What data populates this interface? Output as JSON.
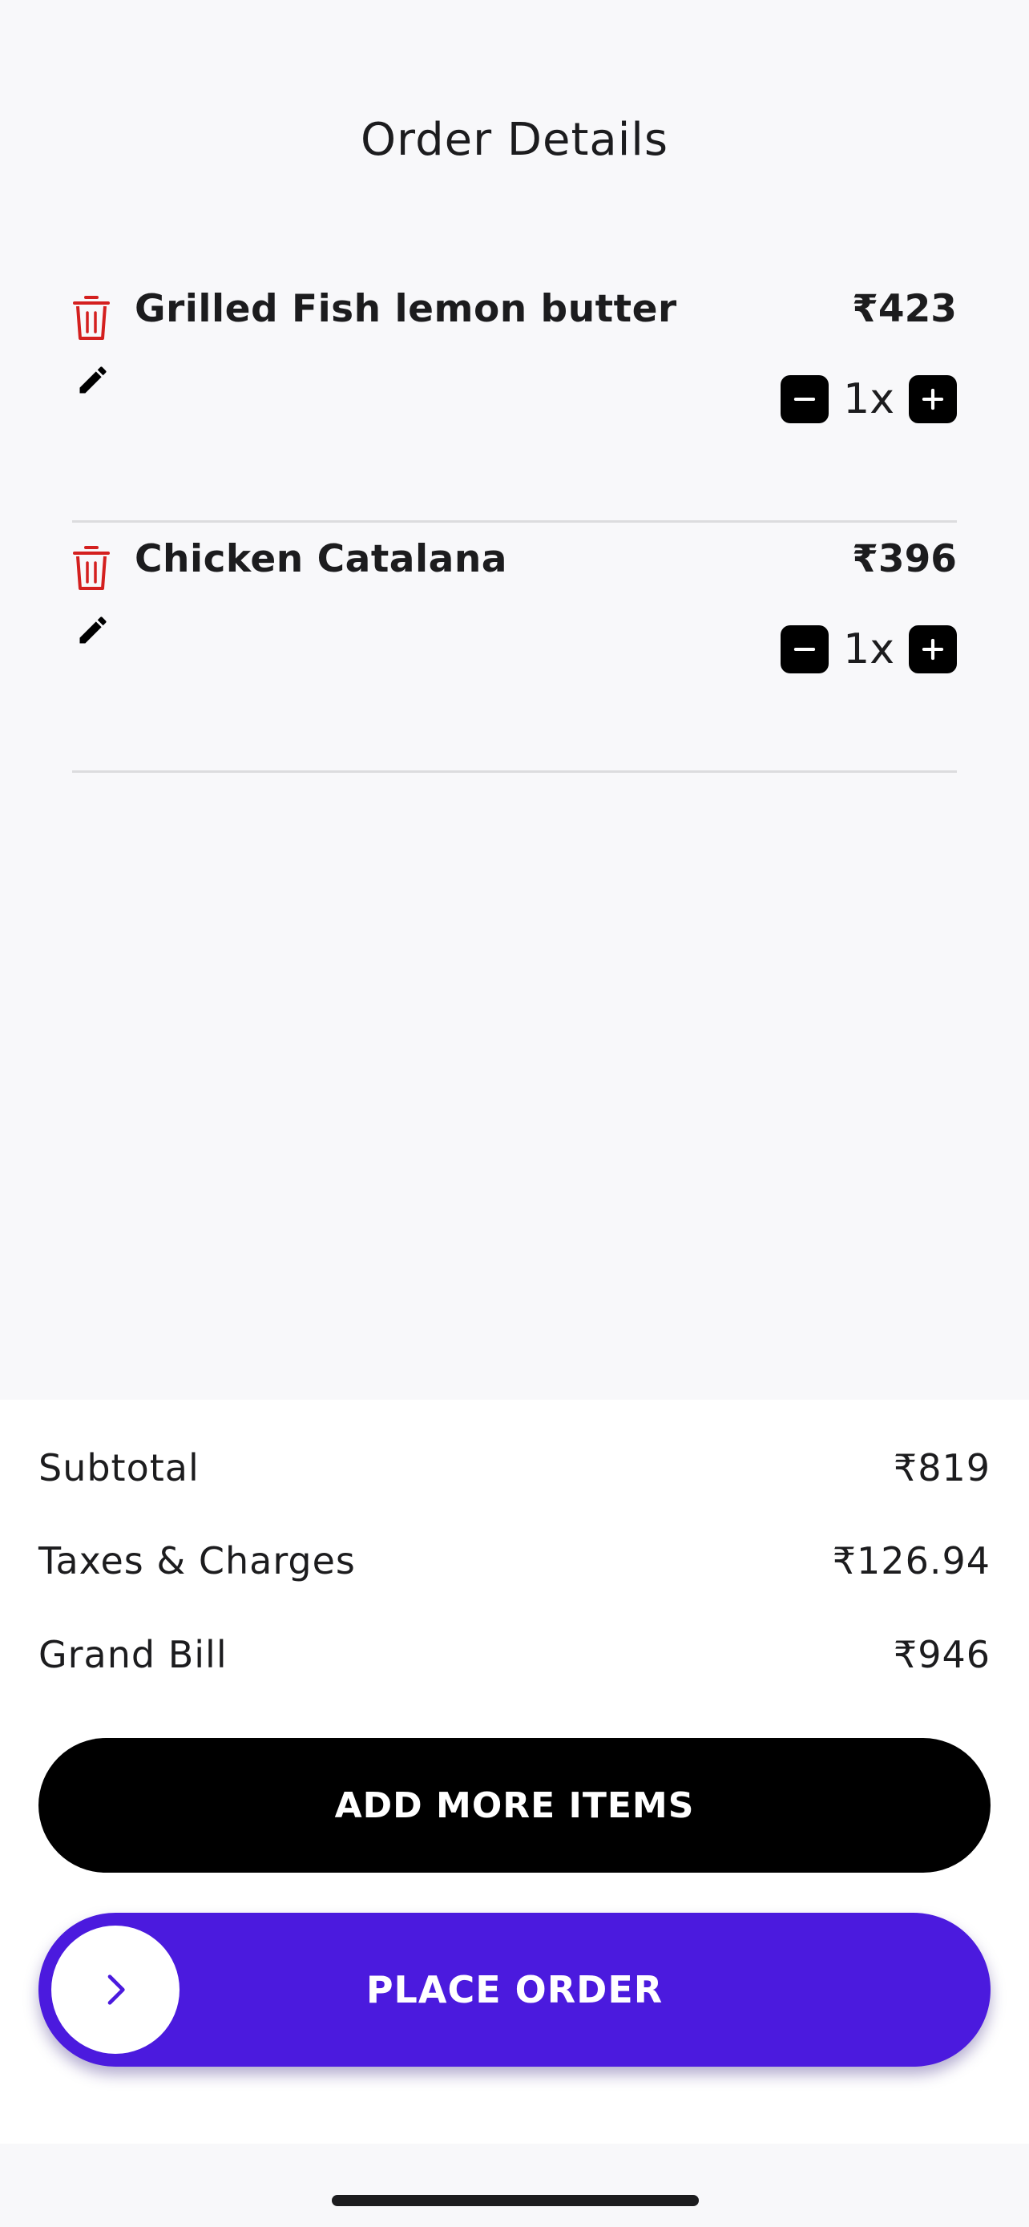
{
  "header": {
    "title": "Order Details"
  },
  "items": [
    {
      "name": "Grilled Fish lemon butter",
      "price": "₹423",
      "qty": "1x"
    },
    {
      "name": "Chicken Catalana",
      "price": "₹396",
      "qty": "1x"
    }
  ],
  "summary": {
    "subtotal_label": "Subtotal",
    "subtotal_value": "₹819",
    "taxes_label": "Taxes & Charges",
    "taxes_value": "₹126.94",
    "grand_label": "Grand Bill",
    "grand_value": "₹946"
  },
  "actions": {
    "add_more_label": "ADD MORE ITEMS",
    "place_order_label": "PLACE ORDER"
  },
  "icons": {
    "delete": "trash-icon",
    "edit": "pencil-icon",
    "decrease": "minus-icon",
    "increase": "plus-icon",
    "slide": "chevron-right-icon"
  },
  "colors": {
    "accent": "#4B1ADE",
    "delete": "#D4201F",
    "background": "#F8F8FA",
    "panel": "#FFFFFF"
  }
}
